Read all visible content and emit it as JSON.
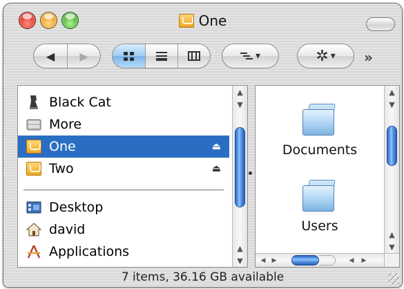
{
  "window": {
    "title": "One"
  },
  "toolbar": {
    "back_glyph": "◀",
    "forward_glyph": "▶",
    "arrange_caret": "▾",
    "action_gear": "✲",
    "action_caret": "▾",
    "more_glyph": "»"
  },
  "sidebar": {
    "devices": [
      {
        "label": "Black Cat",
        "icon": "external-disk-icon"
      },
      {
        "label": "More",
        "icon": "disk-icon"
      },
      {
        "label": "One",
        "icon": "volume-icon",
        "selected": true,
        "eject": "⏏"
      },
      {
        "label": "Two",
        "icon": "volume-icon",
        "eject": "⏏"
      }
    ],
    "places": [
      {
        "label": "Desktop",
        "icon": "desktop-icon"
      },
      {
        "label": "david",
        "icon": "home-icon"
      },
      {
        "label": "Applications",
        "icon": "applications-icon"
      }
    ]
  },
  "column": {
    "items": [
      {
        "label": "Documents",
        "icon": "folder-icon"
      },
      {
        "label": "Users",
        "icon": "folder-icon"
      }
    ]
  },
  "scroll": {
    "up": "▲",
    "down": "▼",
    "left": "◀",
    "right": "▶"
  },
  "status": {
    "text": "7 items, 36.16 GB available"
  },
  "colors": {
    "selection": "#2a6ec3",
    "scroll_thumb": "#5b9ae8",
    "close": "#d8261c",
    "minimize": "#e39a1a",
    "zoom": "#3ea824"
  }
}
